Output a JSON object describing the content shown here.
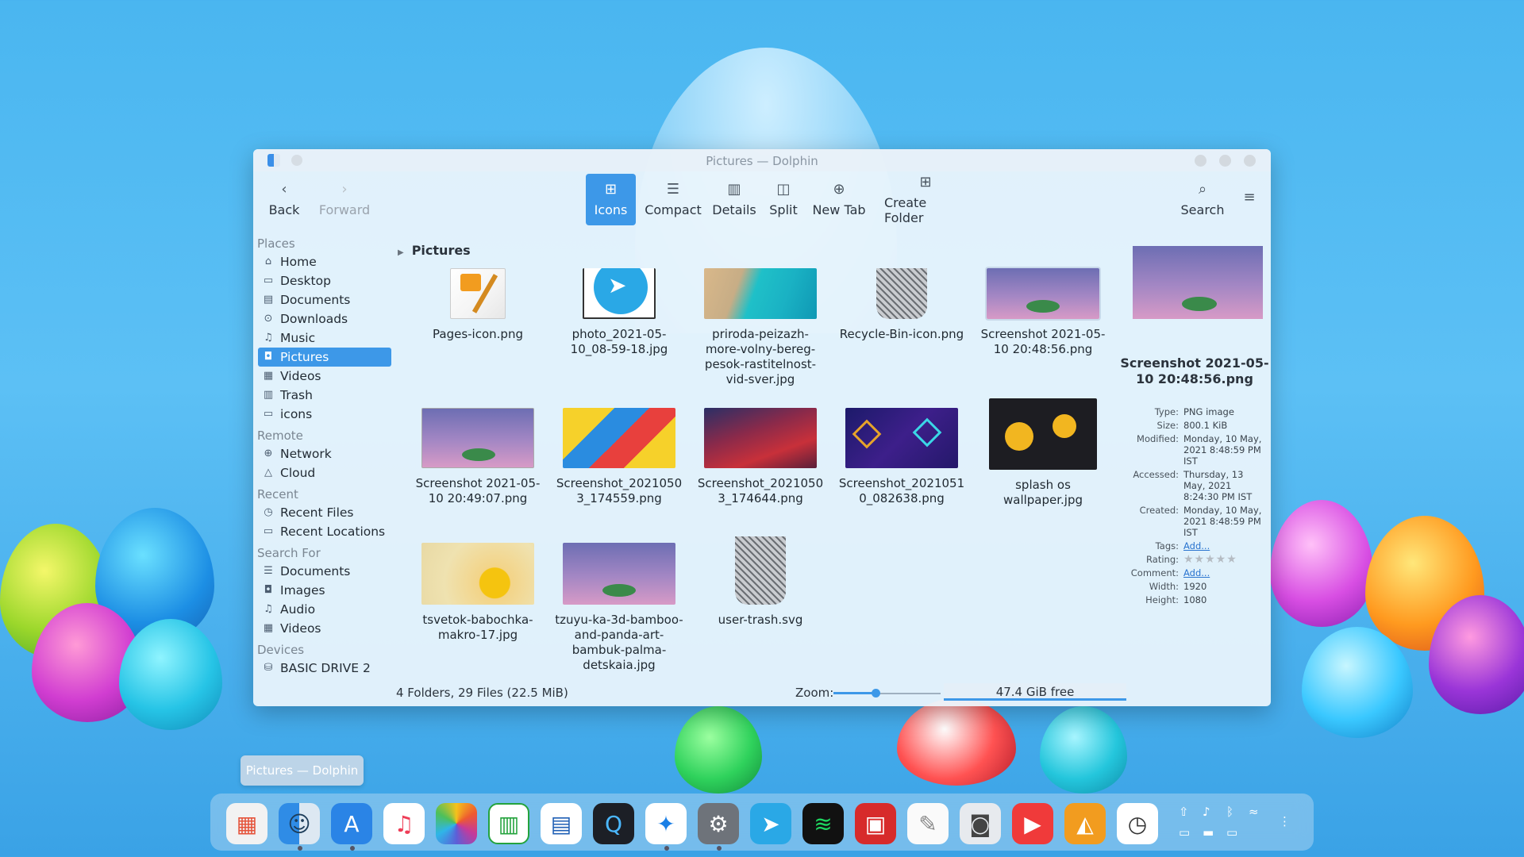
{
  "window": {
    "title": "Pictures — Dolphin"
  },
  "toolbar": {
    "back": "Back",
    "forward": "Forward",
    "icons": "Icons",
    "compact": "Compact",
    "details": "Details",
    "split": "Split",
    "new_tab": "New Tab",
    "create_folder": "Create Folder",
    "search": "Search"
  },
  "sidebar": {
    "places_header": "Places",
    "places": [
      "Home",
      "Desktop",
      "Documents",
      "Downloads",
      "Music",
      "Pictures",
      "Videos",
      "Trash",
      "icons"
    ],
    "remote_header": "Remote",
    "remote": [
      "Network",
      "Cloud"
    ],
    "recent_header": "Recent",
    "recent": [
      "Recent Files",
      "Recent Locations"
    ],
    "search_header": "Search For",
    "search": [
      "Documents",
      "Images",
      "Audio",
      "Videos"
    ],
    "devices_header": "Devices",
    "devices": [
      "BASIC DRIVE 2"
    ]
  },
  "breadcrumb": "Pictures",
  "files": [
    {
      "name": "Pages-icon.png"
    },
    {
      "name": "photo_2021-05-10_08-59-18.jpg"
    },
    {
      "name": "priroda-peizazh-more-volny-bereg-pesok-rastitelnost-vid-sver.jpg"
    },
    {
      "name": "Recycle-Bin-icon.png"
    },
    {
      "name": "Screenshot 2021-05-10 20:48:56.png"
    },
    {
      "name": "Screenshot 2021-05-10 20:49:07.png"
    },
    {
      "name": "Screenshot_20210503_174559.png"
    },
    {
      "name": "Screenshot_20210503_174644.png"
    },
    {
      "name": "Screenshot_20210510_082638.png"
    },
    {
      "name": "splash os wallpaper.jpg"
    },
    {
      "name": "tsvetok-babochka-makro-17.jpg"
    },
    {
      "name": "tzuyu-ka-3d-bamboo-and-panda-art-bambuk-palma-detskaia.jpg"
    },
    {
      "name": "user-trash.svg"
    }
  ],
  "info": {
    "name": "Screenshot 2021-05-10 20:48:56.png",
    "type_k": "Type:",
    "type_v": "PNG image",
    "size_k": "Size:",
    "size_v": "800.1 KiB",
    "modified_k": "Modified:",
    "modified_v": "Monday, 10 May, 2021 8:48:59 PM IST",
    "accessed_k": "Accessed:",
    "accessed_v": "Thursday, 13 May, 2021 8:24:30 PM IST",
    "created_k": "Created:",
    "created_v": "Monday, 10 May, 2021 8:48:59 PM IST",
    "tags_k": "Tags:",
    "tags_v": "Add...",
    "rating_k": "Rating:",
    "rating_v": "★★★★★",
    "comment_k": "Comment:",
    "comment_v": "Add...",
    "width_k": "Width:",
    "width_v": "1920",
    "height_k": "Height:",
    "height_v": "1080"
  },
  "status": {
    "summary": "4 Folders, 29 Files (22.5 MiB)",
    "zoom_label": "Zoom:",
    "zoom_level": 0.38,
    "free": "47.4 GiB free"
  },
  "tooltip": "Pictures — Dolphin",
  "dock": {
    "apps": [
      "launchpad-icon",
      "finder-icon",
      "app-store-icon",
      "music-icon",
      "photos-icon",
      "numbers-icon",
      "pages-icon",
      "quicktime-icon",
      "safari-icon",
      "settings-icon",
      "telegram-icon",
      "spotify-icon",
      "photo-booth-icon",
      "notes-icon",
      "screenshot-icon",
      "video-player-icon",
      "keynote-icon",
      "clock-icon"
    ]
  }
}
